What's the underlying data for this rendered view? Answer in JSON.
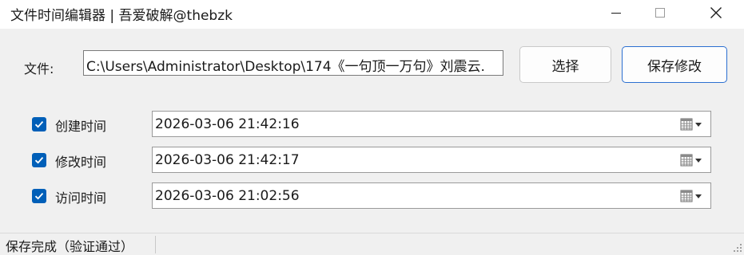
{
  "window": {
    "title": "文件时间编辑器 | 吾爱破解@thebzk"
  },
  "file": {
    "label": "文件:",
    "path": "C:\\Users\\Administrator\\Desktop\\174《一句顶一万句》刘震云."
  },
  "buttons": {
    "select_label": "选择",
    "save_label": "保存修改"
  },
  "times": [
    {
      "label": "创建时间",
      "checked": true,
      "value": "2026-03-06 21:42:16"
    },
    {
      "label": "修改时间",
      "checked": true,
      "value": "2026-03-06 21:42:17"
    },
    {
      "label": "访问时间",
      "checked": true,
      "value": "2026-03-06 21:02:56"
    }
  ],
  "status": {
    "text": "保存完成（验证通过）"
  },
  "colors": {
    "accent": "#005fb8",
    "primary_border": "#2b6fd1"
  },
  "icons": {
    "minimize": "minimize-icon",
    "maximize": "maximize-icon",
    "close": "close-icon",
    "datepicker": "calendar-dropdown-icon",
    "check": "checkmark-icon"
  }
}
